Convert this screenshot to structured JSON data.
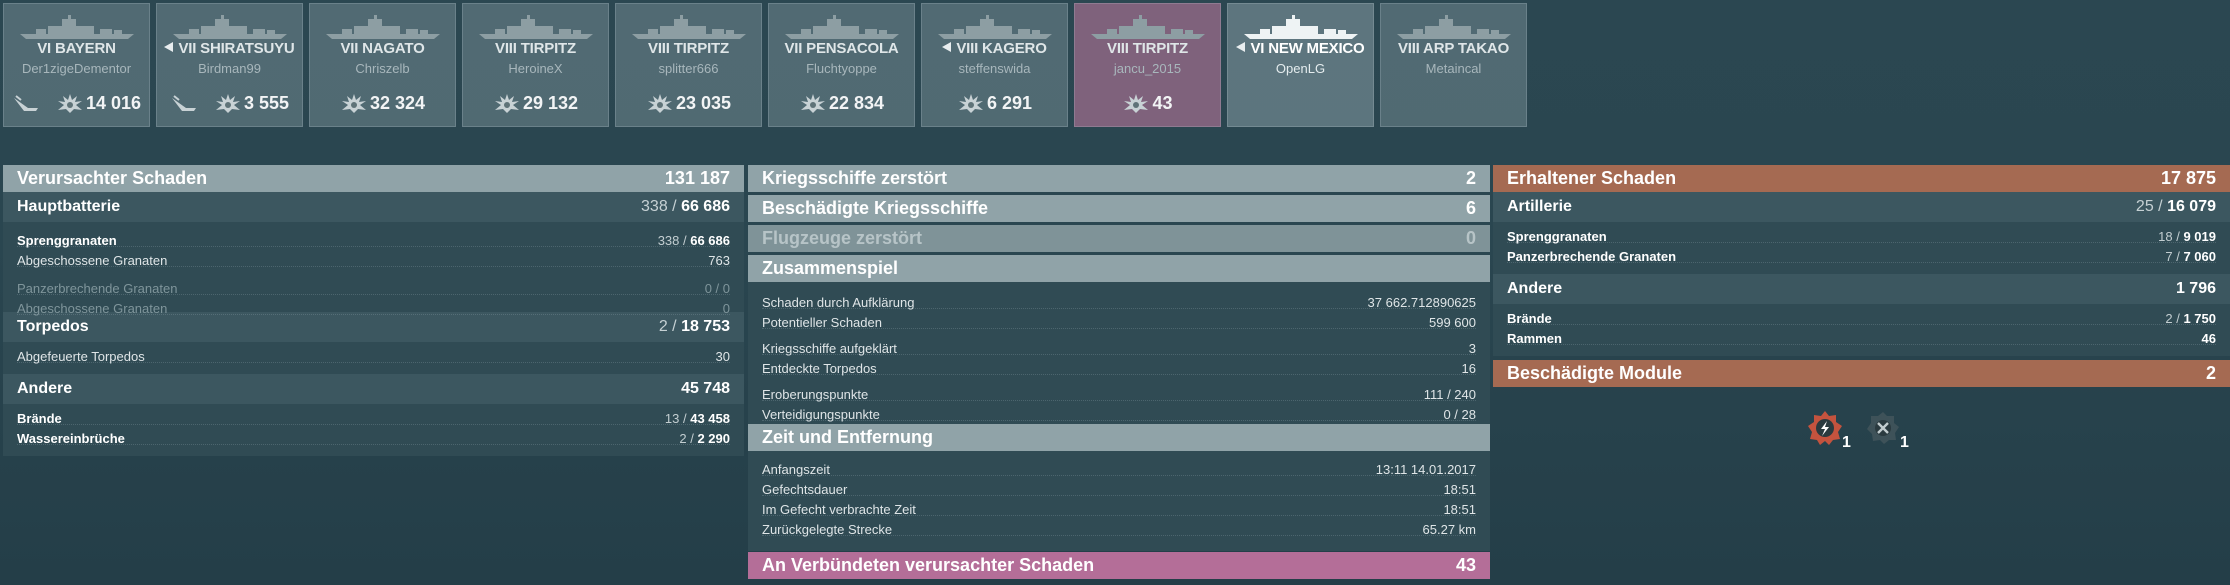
{
  "ships": [
    {
      "tier_name": "VI BAYERN",
      "player": "Der1zigeDementor",
      "show_arrow": false,
      "stats": [
        {
          "icon": "plane-shotdown-icon",
          "value": ""
        },
        {
          "icon": "burst-damage-icon",
          "value": "14 016"
        }
      ]
    },
    {
      "tier_name": "VII SHIRATSUYU",
      "player": "Birdman99",
      "show_arrow": true,
      "stats": [
        {
          "icon": "plane-shotdown-icon",
          "value": ""
        },
        {
          "icon": "burst-damage-icon",
          "value": "3 555"
        }
      ]
    },
    {
      "tier_name": "VII NAGATO",
      "player": "Chriszelb",
      "show_arrow": false,
      "stats": [
        {
          "icon": "burst-damage-icon",
          "value": "32 324"
        }
      ]
    },
    {
      "tier_name": "VIII TIRPITZ",
      "player": "HeroineX",
      "show_arrow": false,
      "stats": [
        {
          "icon": "burst-damage-icon",
          "value": "29 132"
        }
      ]
    },
    {
      "tier_name": "VIII TIRPITZ",
      "player": "splitter666",
      "show_arrow": false,
      "stats": [
        {
          "icon": "burst-damage-icon",
          "value": "23 035"
        }
      ]
    },
    {
      "tier_name": "VII PENSACOLA",
      "player": "Fluchtyoppe",
      "show_arrow": false,
      "stats": [
        {
          "icon": "burst-damage-icon",
          "value": "22 834"
        }
      ]
    },
    {
      "tier_name": "VIII KAGERO",
      "player": "steffenswida",
      "show_arrow": true,
      "stats": [
        {
          "icon": "burst-damage-icon",
          "value": "6 291"
        }
      ]
    },
    {
      "tier_name": "VIII TIRPITZ",
      "player": "jancu_2015",
      "show_arrow": false,
      "stats": [
        {
          "icon": "burst-damage-icon",
          "value": "43"
        }
      ]
    },
    {
      "tier_name": "VI NEW MEXICO",
      "player": "OpenLG",
      "show_arrow": true,
      "stats": []
    },
    {
      "tier_name": "VIII ARP TAKAO",
      "player": "Metaincal",
      "show_arrow": false,
      "stats": []
    }
  ],
  "damage_dealt": {
    "title": "Verursachter Schaden",
    "total": "131 187",
    "main_battery": {
      "label": "Hauptbatterie",
      "hits": "338 /",
      "damage": "66 686"
    },
    "he_shells": {
      "label": "Sprenggranaten",
      "hits": "338 /",
      "damage": "66 686"
    },
    "he_fired": {
      "label": "Abgeschossene Granaten",
      "value": "763"
    },
    "ap_shells": {
      "label": "Panzerbrechende Granaten",
      "value": "0 / 0"
    },
    "ap_fired": {
      "label": "Abgeschossene Granaten",
      "value": "0"
    },
    "torpedoes": {
      "label": "Torpedos",
      "hits": "2 /",
      "damage": "18 753"
    },
    "torps_fired": {
      "label": "Abgefeuerte Torpedos",
      "value": "30"
    },
    "other": {
      "label": "Andere",
      "value": "45 748"
    },
    "fires": {
      "label": "Brände",
      "count": "13 /",
      "damage": "43 458"
    },
    "floods": {
      "label": "Wassereinbrüche",
      "count": "2 /",
      "damage": "2 290"
    }
  },
  "middle": {
    "ships_destroyed": {
      "label": "Kriegsschiffe zerstört",
      "value": "2"
    },
    "ships_damaged": {
      "label": "Beschädigte Kriegsschiffe",
      "value": "6"
    },
    "planes_destroyed": {
      "label": "Flugzeuge zerstört",
      "value": "0"
    },
    "teamwork": {
      "title": "Zusammenspiel",
      "spotting_damage": {
        "label": "Schaden durch Aufklärung",
        "value": "37 662.712890625"
      },
      "potential_damage": {
        "label": "Potentieller Schaden",
        "value": "599 600"
      },
      "ships_spotted": {
        "label": "Kriegsschiffe aufgeklärt",
        "value": "3"
      },
      "torps_spotted": {
        "label": "Entdeckte Torpedos",
        "value": "16"
      },
      "capture_points": {
        "label": "Eroberungspunkte",
        "value": "111 / 240"
      },
      "defense_points": {
        "label": "Verteidigungspunkte",
        "value": "0 / 28"
      }
    },
    "time": {
      "title": "Zeit und Entfernung",
      "start": {
        "label": "Anfangszeit",
        "value": "13:11  14.01.2017"
      },
      "duration": {
        "label": "Gefechtsdauer",
        "value": "18:51"
      },
      "in_battle": {
        "label": "Im Gefecht verbrachte Zeit",
        "value": "18:51"
      },
      "distance": {
        "label": "Zurückgelegte Strecke",
        "value": "65.27 km"
      }
    },
    "ally_damage": {
      "label": "An Verbündeten verursachter Schaden",
      "value": "43"
    }
  },
  "received": {
    "title": "Erhaltener Schaden",
    "total": "17 875",
    "artillery": {
      "label": "Artillerie",
      "hits": "25 /",
      "damage": "16 079"
    },
    "he": {
      "label": "Sprenggranaten",
      "hits": "18 /",
      "damage": "9 019"
    },
    "ap": {
      "label": "Panzerbrechende Granaten",
      "hits": "7 /",
      "damage": "7 060"
    },
    "other": {
      "label": "Andere",
      "value": "1 796"
    },
    "fires": {
      "label": "Brände",
      "count": "2 /",
      "damage": "1 750"
    },
    "ramming": {
      "label": "Rammen",
      "value": "46"
    },
    "modules": {
      "label": "Beschädigte Module",
      "value": "2",
      "items": [
        {
          "icon": "engine-damaged-icon",
          "count": "1"
        },
        {
          "icon": "steering-damaged-icon",
          "count": "1"
        }
      ]
    }
  },
  "colors": {
    "accent_pink": "#b46e98",
    "accent_orange": "#a56a52",
    "panel_grey": "#90a3a8"
  }
}
